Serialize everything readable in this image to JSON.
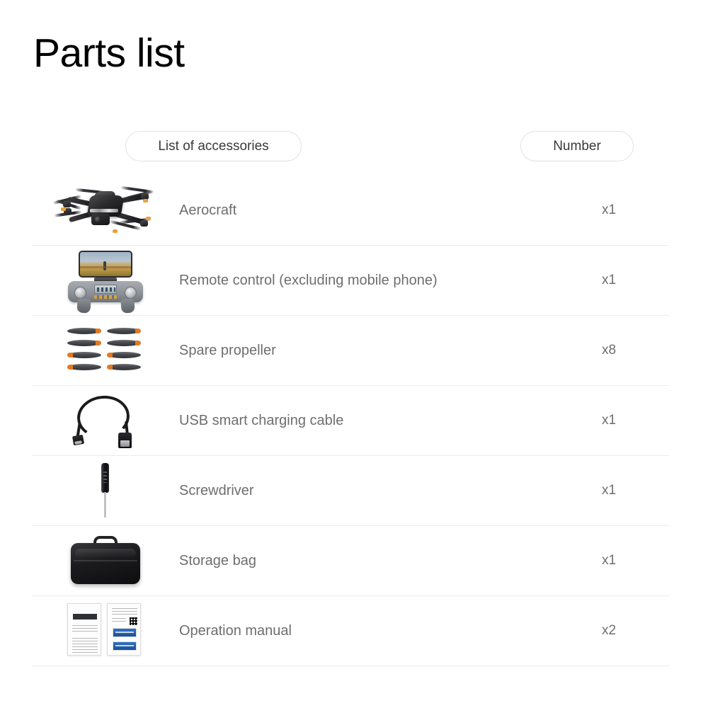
{
  "page": {
    "title": "Parts list"
  },
  "header": {
    "accessories_label": "List of accessories",
    "number_label": "Number"
  },
  "colors": {
    "title": "#000000",
    "label_text": "#6e6e6e",
    "pill_text": "#3a3a3a",
    "pill_border": "#e2e2e2",
    "divider": "#ececec",
    "background": "#ffffff",
    "propeller_tip": "#e07a22"
  },
  "rows": [
    {
      "icon": "drone-thumbnail",
      "label": "Aerocraft",
      "qty": "x1"
    },
    {
      "icon": "remote-control-thumbnail",
      "label": "Remote control (excluding mobile phone)",
      "qty": "x1"
    },
    {
      "icon": "propellers-thumbnail",
      "label": "Spare propeller",
      "qty": "x8"
    },
    {
      "icon": "usb-cable-thumbnail",
      "label": "USB smart charging cable",
      "qty": "x1"
    },
    {
      "icon": "screwdriver-thumbnail",
      "label": "Screwdriver",
      "qty": "x1"
    },
    {
      "icon": "storage-bag-thumbnail",
      "label": "Storage bag",
      "qty": "x1"
    },
    {
      "icon": "operation-manual-thumbnail",
      "label": "Operation manual",
      "qty": "x2"
    }
  ]
}
